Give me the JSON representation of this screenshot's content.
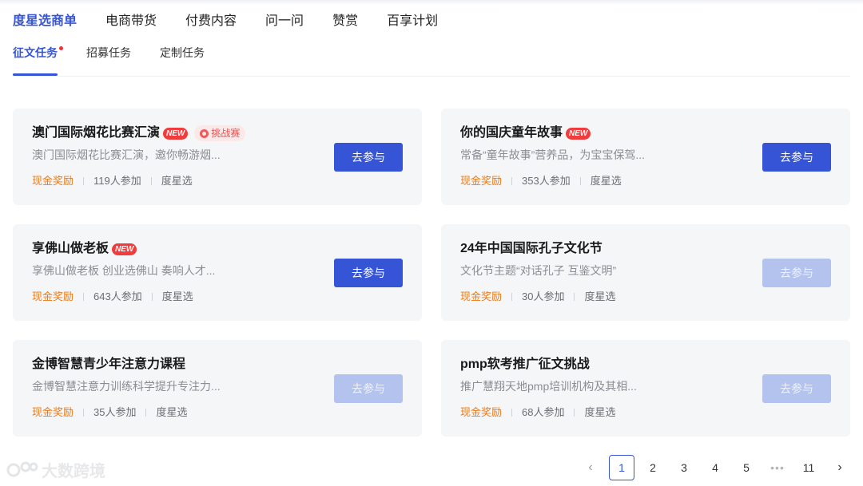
{
  "main_tabs": [
    "度星选商单",
    "电商带货",
    "付费内容",
    "问一问",
    "赞赏",
    "百享计划"
  ],
  "sub_tabs": [
    "征文任务",
    "招募任务",
    "定制任务"
  ],
  "cards": [
    {
      "title": "澳门国际烟花比赛汇演",
      "badge_new": "NEW",
      "badge_challenge": "挑战赛",
      "desc": "澳门国际烟花比赛汇演，邀你畅游烟...",
      "reward": "现金奖励",
      "participants": "119人参加",
      "source": "度星选",
      "button": "去参与",
      "enabled": true
    },
    {
      "title": "你的国庆童年故事",
      "badge_new": "NEW",
      "badge_challenge": "",
      "desc": "常备“童年故事”营养品，为宝宝保驾...",
      "reward": "现金奖励",
      "participants": "353人参加",
      "source": "度星选",
      "button": "去参与",
      "enabled": true
    },
    {
      "title": "享佛山做老板",
      "badge_new": "NEW",
      "badge_challenge": "",
      "desc": "享佛山做老板 创业选佛山 奏响人才...",
      "reward": "现金奖励",
      "participants": "643人参加",
      "source": "度星选",
      "button": "去参与",
      "enabled": true
    },
    {
      "title": "24年中国国际孔子文化节",
      "badge_new": "",
      "badge_challenge": "",
      "desc": "文化节主题“对话孔子 互鉴文明”",
      "reward": "现金奖励",
      "participants": "30人参加",
      "source": "度星选",
      "button": "去参与",
      "enabled": false
    },
    {
      "title": "金博智慧青少年注意力课程",
      "badge_new": "",
      "badge_challenge": "",
      "desc": "金博智慧注意力训练科学提升专注力...",
      "reward": "现金奖励",
      "participants": "35人参加",
      "source": "度星选",
      "button": "去参与",
      "enabled": false
    },
    {
      "title": "pmp软考推广征文挑战",
      "badge_new": "",
      "badge_challenge": "",
      "desc": "推广慧翔天地pmp培训机构及其相...",
      "reward": "现金奖励",
      "participants": "68人参加",
      "source": "度星选",
      "button": "去参与",
      "enabled": false
    }
  ],
  "pagination": {
    "prev": "‹",
    "pages": [
      "1",
      "2",
      "3",
      "4",
      "5"
    ],
    "ellipsis": "•••",
    "last": "11",
    "next": "›",
    "current": "1"
  },
  "watermark": "大数跨境",
  "colors": {
    "accent": "#3654d6",
    "reward": "#ec7a16",
    "new_badge": "#f03c3c",
    "disabled_button": "#b4c3ee"
  }
}
